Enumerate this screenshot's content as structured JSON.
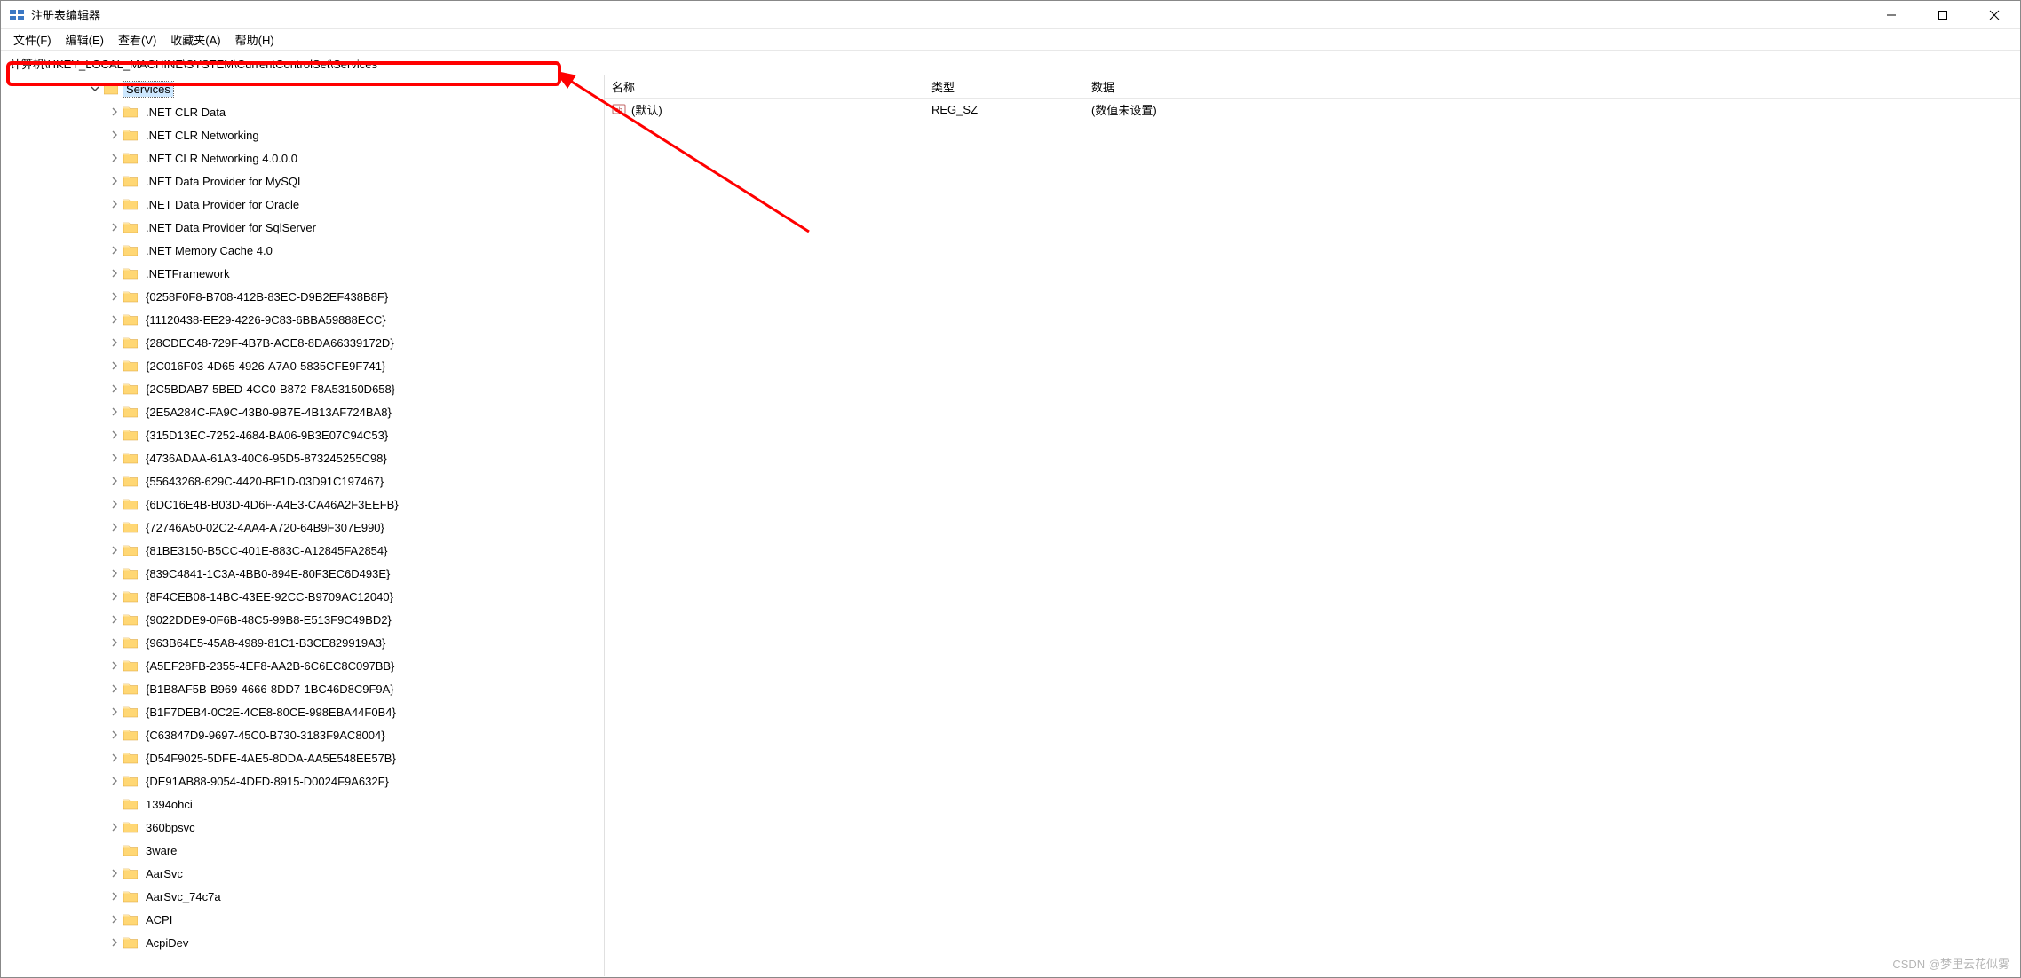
{
  "app": {
    "title": "注册表编辑器"
  },
  "menu": {
    "file": "文件(F)",
    "edit": "编辑(E)",
    "view": "查看(V)",
    "favorites": "收藏夹(A)",
    "help": "帮助(H)"
  },
  "address": {
    "path": "计算机\\HKEY_LOCAL_MACHINE\\SYSTEM\\CurrentControlSet\\Services"
  },
  "tree": {
    "root_label": "Services",
    "items": [
      ".NET CLR Data",
      ".NET CLR Networking",
      ".NET CLR Networking 4.0.0.0",
      ".NET Data Provider for MySQL",
      ".NET Data Provider for Oracle",
      ".NET Data Provider for SqlServer",
      ".NET Memory Cache 4.0",
      ".NETFramework",
      "{0258F0F8-B708-412B-83EC-D9B2EF438B8F}",
      "{11120438-EE29-4226-9C83-6BBA59888ECC}",
      "{28CDEC48-729F-4B7B-ACE8-8DA66339172D}",
      "{2C016F03-4D65-4926-A7A0-5835CFE9F741}",
      "{2C5BDAB7-5BED-4CC0-B872-F8A53150D658}",
      "{2E5A284C-FA9C-43B0-9B7E-4B13AF724BA8}",
      "{315D13EC-7252-4684-BA06-9B3E07C94C53}",
      "{4736ADAA-61A3-40C6-95D5-873245255C98}",
      "{55643268-629C-4420-BF1D-03D91C197467}",
      "{6DC16E4B-B03D-4D6F-A4E3-CA46A2F3EEFB}",
      "{72746A50-02C2-4AA4-A720-64B9F307E990}",
      "{81BE3150-B5CC-401E-883C-A12845FA2854}",
      "{839C4841-1C3A-4BB0-894E-80F3EC6D493E}",
      "{8F4CEB08-14BC-43EE-92CC-B9709AC12040}",
      "{9022DDE9-0F6B-48C5-99B8-E513F9C49BD2}",
      "{963B64E5-45A8-4989-81C1-B3CE829919A3}",
      "{A5EF28FB-2355-4EF8-AA2B-6C6EC8C097BB}",
      "{B1B8AF5B-B969-4666-8DD7-1BC46D8C9F9A}",
      "{B1F7DEB4-0C2E-4CE8-80CE-998EBA44F0B4}",
      "{C63847D9-9697-45C0-B730-3183F9AC8004}",
      "{D54F9025-5DFE-4AE5-8DDA-AA5E548EE57B}",
      "{DE91AB88-9054-4DFD-8915-D0024F9A632F}",
      "1394ohci",
      "360bpsvc",
      "3ware",
      "AarSvc",
      "AarSvc_74c7a",
      "ACPI",
      "AcpiDev"
    ]
  },
  "list": {
    "columns": {
      "name": "名称",
      "type": "类型",
      "data": "数据"
    },
    "rows": [
      {
        "name": "(默认)",
        "type": "REG_SZ",
        "data": "(数值未设置)"
      }
    ]
  },
  "watermark": "CSDN @梦里云花似雾"
}
